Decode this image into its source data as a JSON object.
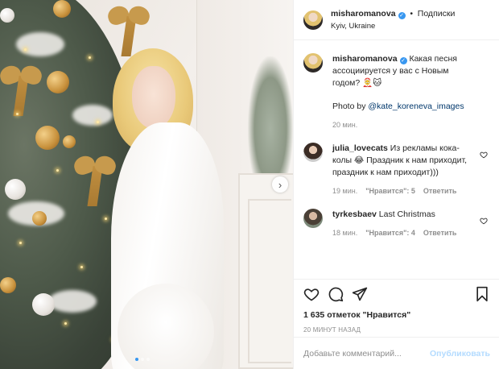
{
  "post": {
    "author": "misharomanova",
    "follow_label": "Подписки",
    "location": "Kyiv, Ukraine",
    "caption_text": "Какая песня ассоциируется у вас с Новым годом? 🤶🐱",
    "photo_by_prefix": "Photo by",
    "photo_by_handle": "@kate_koreneva_images",
    "caption_time": "20 мин.",
    "likes_text": "1 635 отметок \"Нравится\"",
    "time_ago": "20 МИНУТ НАЗАД",
    "carousel": {
      "count": 3,
      "active_index": 0
    }
  },
  "comments": [
    {
      "user": "julia_lovecats",
      "text": "Из рекламы кока-колы 😂 Праздник к нам приходит, праздник к нам приходит)))",
      "time": "19 мин.",
      "likes": "\"Нравится\": 5",
      "reply": "Ответить"
    },
    {
      "user": "tyrkesbaev",
      "text": "Last Christmas",
      "time": "18 мин.",
      "likes": "\"Нравится\": 4",
      "reply": "Ответить"
    }
  ],
  "add_comment": {
    "placeholder": "Добавьте комментарий...",
    "publish_label": "Опубликовать"
  },
  "colors": {
    "accent": "#3897f0",
    "link": "#00376b",
    "muted": "#8e8e8e",
    "publish_disabled": "#b3dbff"
  }
}
